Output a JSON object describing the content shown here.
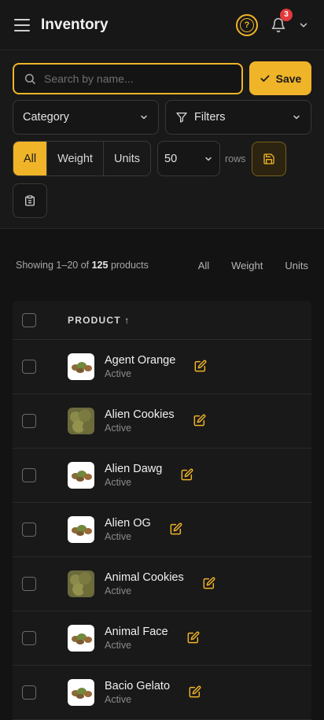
{
  "header": {
    "title": "Inventory",
    "help_glyph": "?",
    "notifications_count": "3",
    "accent": "#f0b429"
  },
  "controls": {
    "search_placeholder": "Search by name...",
    "save_label": "Save",
    "category_label": "Category",
    "filters_label": "Filters",
    "segments": [
      "All",
      "Weight",
      "Units"
    ],
    "active_segment": "All",
    "rows_value": "50",
    "rows_label": "rows"
  },
  "summary": {
    "prefix": "Showing 1–20 of ",
    "total": "125",
    "suffix": " products",
    "links": [
      "All",
      "Weight",
      "Units"
    ]
  },
  "table": {
    "column_header": "PRODUCT ↑",
    "rows": [
      {
        "name": "Agent Orange",
        "status": "Active",
        "thumb": "light"
      },
      {
        "name": "Alien Cookies",
        "status": "Active",
        "thumb": "full"
      },
      {
        "name": "Alien Dawg",
        "status": "Active",
        "thumb": "light"
      },
      {
        "name": "Alien OG",
        "status": "Active",
        "thumb": "light"
      },
      {
        "name": "Animal Cookies",
        "status": "Active",
        "thumb": "full"
      },
      {
        "name": "Animal Face",
        "status": "Active",
        "thumb": "light"
      },
      {
        "name": "Bacio Gelato",
        "status": "Active",
        "thumb": "light"
      }
    ]
  }
}
